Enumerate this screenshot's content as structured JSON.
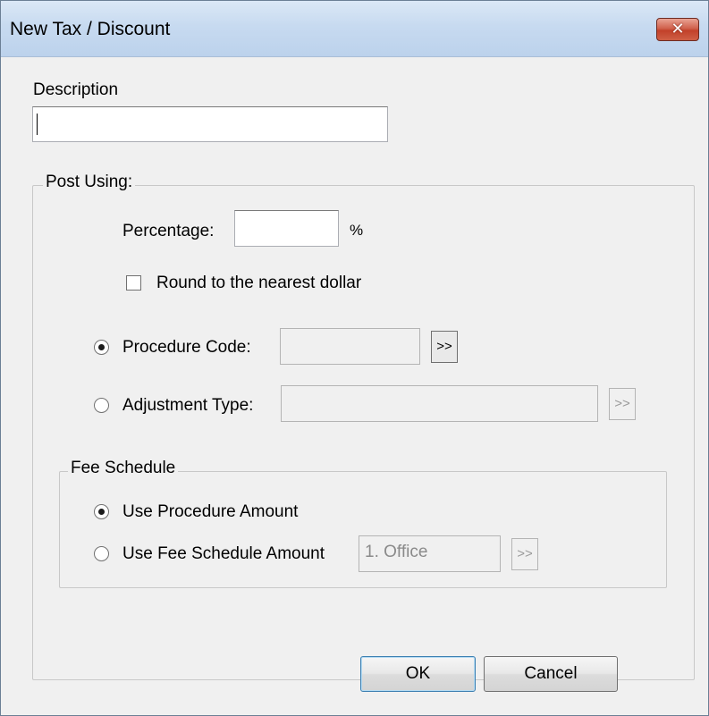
{
  "window": {
    "title": "New Tax / Discount",
    "close_glyph": "✕",
    "close_icon": "close-icon"
  },
  "description": {
    "label": "Description",
    "value": ""
  },
  "post_using": {
    "legend": "Post Using:",
    "percentage_label": "Percentage:",
    "percentage_value": "",
    "percent_sign": "%",
    "round_label": "Round to the nearest dollar",
    "round_checked": false,
    "procedure_code_label": "Procedure Code:",
    "procedure_code_value": "",
    "procedure_code_selected": true,
    "procedure_browse_label": ">>",
    "adjustment_type_label": "Adjustment Type:",
    "adjustment_type_value": "",
    "adjustment_type_selected": false,
    "adjustment_browse_label": ">>"
  },
  "fee_schedule": {
    "legend": "Fee Schedule",
    "use_procedure_amount_label": "Use Procedure Amount",
    "use_procedure_amount_selected": true,
    "use_fee_schedule_amount_label": "Use Fee Schedule Amount",
    "use_fee_schedule_amount_selected": false,
    "fee_schedule_value": "1. Office",
    "fee_schedule_browse_label": ">>"
  },
  "buttons": {
    "ok_label": "OK",
    "cancel_label": "Cancel"
  },
  "colors": {
    "titlebar": "#c7daf0",
    "close_button": "#c2412a",
    "dialog_background": "#f0f0f0"
  }
}
